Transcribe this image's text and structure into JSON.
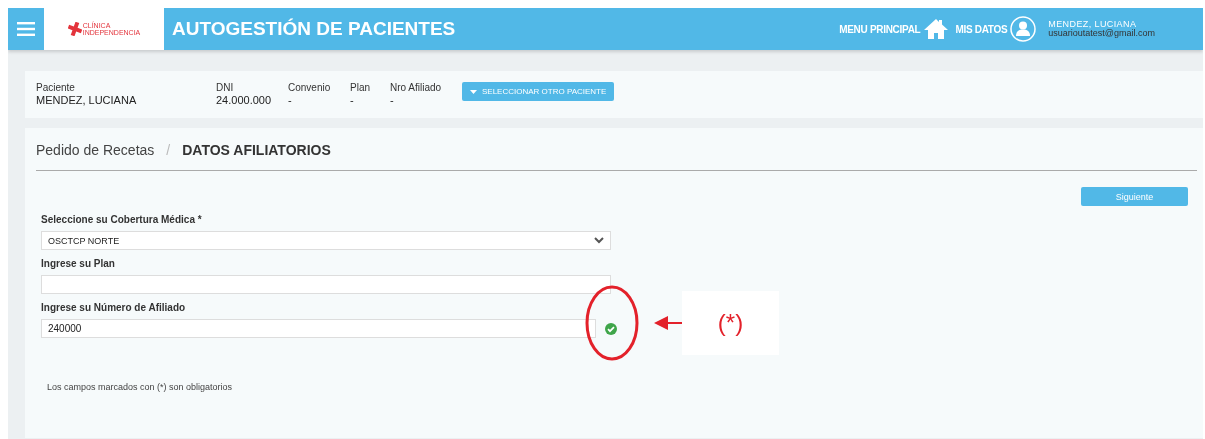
{
  "header": {
    "logo": {
      "line_1": "CLÍNICA",
      "line_2": "INDEPENDENCIA"
    },
    "title": "AUTOGESTIÓN DE PACIENTES",
    "nav": [
      {
        "label": "MENU PRINCIPAL",
        "kind": "home"
      },
      {
        "label": "MIS DATOS",
        "kind": "user"
      }
    ],
    "user": {
      "name": "MENDEZ, LUCIANA",
      "email": "usuarioutatest@gmail.com"
    }
  },
  "patient_bar": {
    "fields": [
      {
        "label": "Paciente",
        "value": "MENDEZ, LUCIANA"
      },
      {
        "label": "DNI",
        "value": "24.000.000"
      },
      {
        "label": "Convenio",
        "value": "-"
      },
      {
        "label": "Plan",
        "value": "-"
      },
      {
        "label": "Nro Afiliado",
        "value": "-"
      }
    ],
    "button": "SELECCIONAR OTRO PACIENTE"
  },
  "breadcrumb": {
    "parent": "Pedido de Recetas",
    "separator": "/",
    "current": "DATOS AFILIATORIOS"
  },
  "next_button": "Siguiente",
  "form": [
    {
      "kind": "select",
      "label": "Seleccione su Cobertura Médica *",
      "value": "OSCTCP NORTE"
    },
    {
      "kind": "text",
      "label": "Ingrese su Plan"
    },
    {
      "kind": "text",
      "label": "Ingrese su Número de Afiliado",
      "value": "240000",
      "valid": true
    }
  ],
  "footnote": "Los campos marcados con (*) son obligatorios",
  "annotation": {
    "text": "(*)"
  }
}
